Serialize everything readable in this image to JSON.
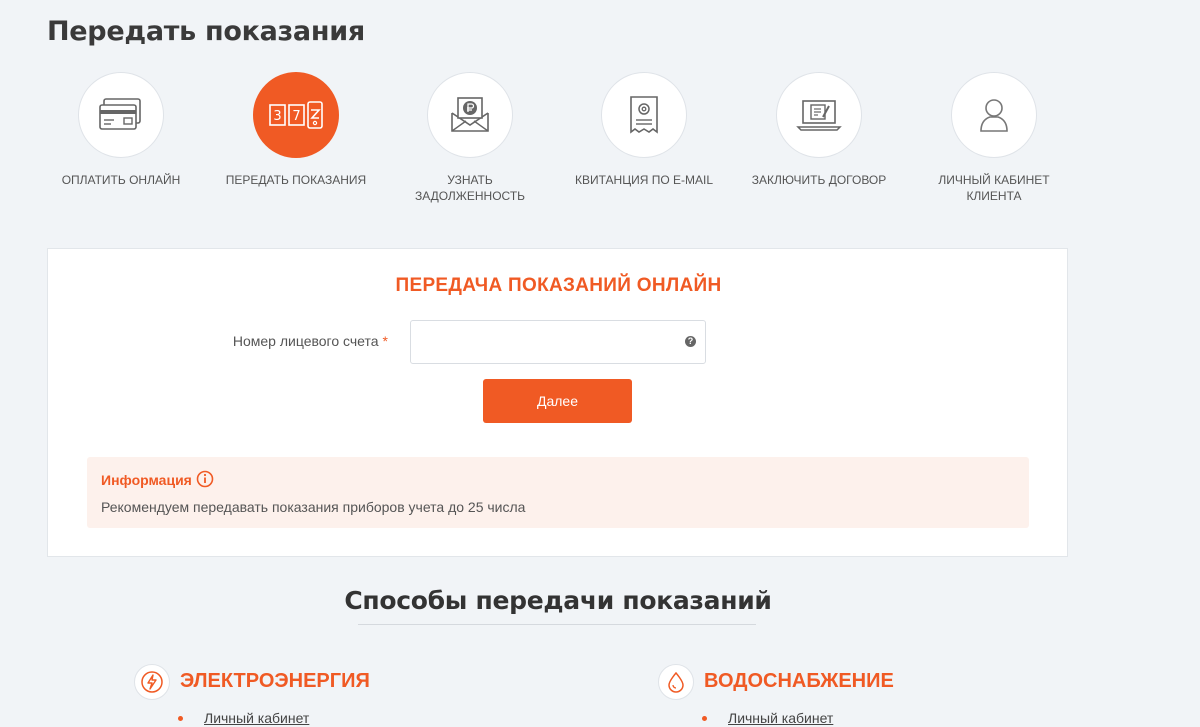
{
  "page": {
    "title": "Передать показания"
  },
  "services": [
    {
      "label": "Оплатить онлайн",
      "icon": "credit-card-icon"
    },
    {
      "label": "Передать показания",
      "icon": "meter-counter-icon",
      "active": true
    },
    {
      "label": "Узнать задолженность",
      "icon": "ruble-envelope-icon"
    },
    {
      "label": "Квитанция по e-mail",
      "icon": "email-receipt-icon"
    },
    {
      "label": "Заключить договор",
      "icon": "laptop-contract-icon"
    },
    {
      "label": "Личный кабинет клиента",
      "icon": "user-icon"
    }
  ],
  "meter_digits": [
    "3",
    "7"
  ],
  "form": {
    "title": "ПЕРЕДАЧА ПОКАЗАНИЙ ОНЛАЙН",
    "account_label": "Номер лицевого счета",
    "required_mark": "*",
    "account_value": "",
    "help_glyph": "?",
    "submit_label": "Далее"
  },
  "info": {
    "title": "Информация",
    "text": "Рекомендуем передавать показания приборов учета до 25 числа"
  },
  "methods": {
    "title": "Способы передачи показаний",
    "items": [
      {
        "title": "ЭЛЕКТРОЭНЕРГИЯ",
        "icon": "lightning-icon",
        "link": "Личный кабинет"
      },
      {
        "title": "ВОДОСНАБЖЕНИЕ",
        "icon": "water-drop-icon",
        "link": "Личный кабинет"
      }
    ]
  },
  "colors": {
    "accent": "#f05a24",
    "background": "#f1f4f7",
    "info_bg": "#fdf1ec"
  }
}
